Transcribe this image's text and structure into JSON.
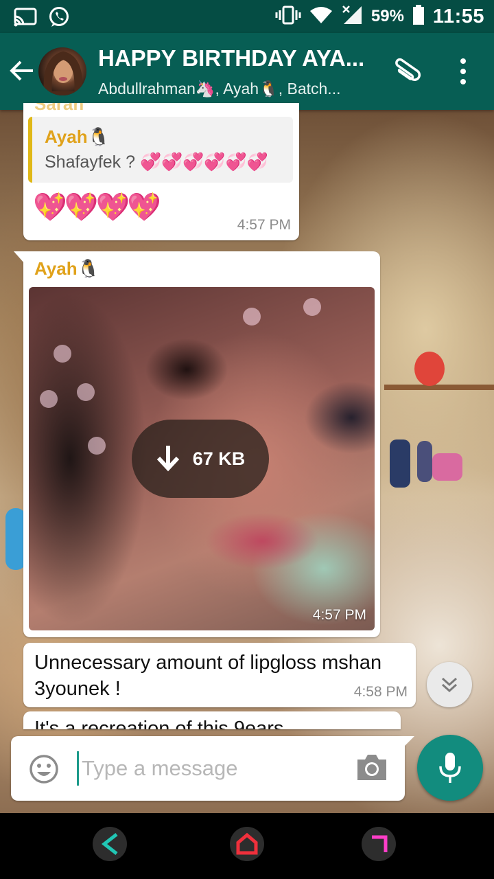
{
  "status_bar": {
    "battery": "59%",
    "time": "11:55"
  },
  "header": {
    "title": "HAPPY BIRTHDAY AYA...",
    "subtitle": "Abdullrahman🦄, Ayah🐧, Batch..."
  },
  "messages": [
    {
      "partial_sender": "Sarah",
      "quote_sender": "Ayah🐧",
      "quote_text": "Shafayfek ? 💞💞💞💞💞💞",
      "text": "💖💖💖💖",
      "time": "4:57 PM"
    },
    {
      "sender": "Ayah🐧",
      "download_size": "67 KB",
      "time": "4:57 PM"
    },
    {
      "text": "Unnecessary amount of lipgloss mshan 3younek !",
      "time": "4:58 PM"
    },
    {
      "text": "It's a recreation of this 9ears"
    }
  ],
  "composer": {
    "placeholder": "Type a message"
  },
  "icons": {
    "cast": "cast-icon",
    "whatsapp": "whatsapp-icon",
    "vibrate": "vibrate-icon",
    "wifi": "wifi-icon",
    "signal": "signal-icon",
    "battery": "battery-icon",
    "back": "arrow-left-icon",
    "attach": "paperclip-icon",
    "menu": "more-vert-icon",
    "download": "download-arrow-icon",
    "scroll_down": "double-chevron-down-icon",
    "emoji": "smiley-icon",
    "camera": "camera-icon",
    "mic": "microphone-icon"
  },
  "colors": {
    "header": "#075e54",
    "status_bar": "#054d44",
    "accent": "#128c7e",
    "sender_name": "#e0a21b"
  }
}
